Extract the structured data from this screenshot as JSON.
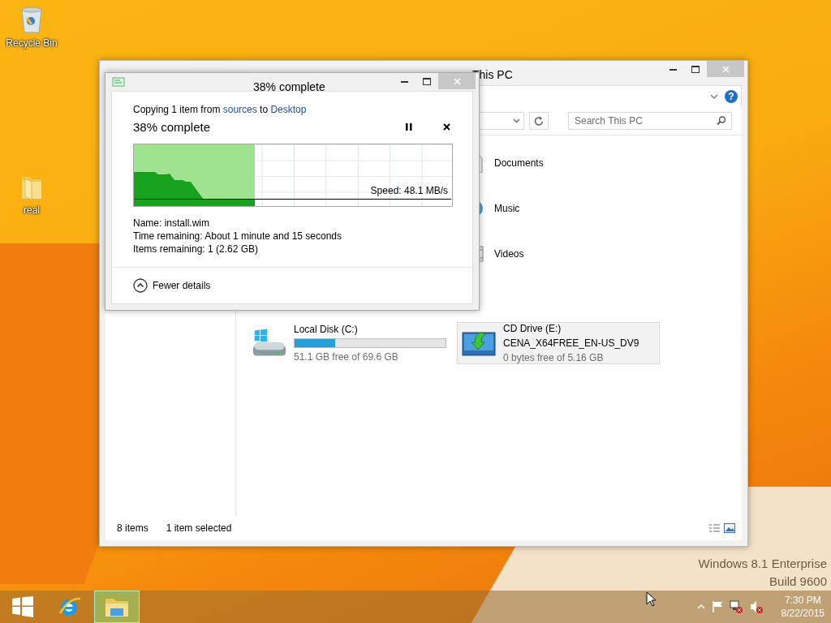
{
  "desktop_icons": [
    {
      "label": "Recycle Bin",
      "kind": "bin"
    },
    {
      "label": "real",
      "kind": "folder"
    }
  ],
  "explorer": {
    "title": "This PC",
    "help": "?",
    "search": {
      "placeholder": "Search This PC"
    },
    "folders": [
      {
        "label": "Documents"
      },
      {
        "label": "Music"
      },
      {
        "label": "Videos"
      }
    ],
    "drives": [
      {
        "name": "Local Disk (C:)",
        "kind": "disk",
        "level": 0.27,
        "free": "51.1 GB free of 69.6 GB",
        "selected": false
      },
      {
        "name": "CD Drive (E:)",
        "kind": "cd",
        "volume": "CENA_X64FREE_EN-US_DV9",
        "free": "0 bytes free of 5.16 GB",
        "selected": true
      }
    ],
    "status_bar": {
      "count": "8 items",
      "selection": "1 item selected"
    }
  },
  "copy_dialog": {
    "title": "38% complete",
    "prefix": "Copying 1 item from",
    "source": "sources",
    "connector": "to",
    "destination": "Desktop",
    "heading": "38% complete",
    "level": 0.38,
    "speed": "Speed: 48.1 MB/s",
    "details": [
      "Name:  install.wim",
      "Time remaining:  About 1 minute and 15 seconds",
      "Items remaining:  1 (2.62 GB)"
    ],
    "toggle": "Fewer details"
  },
  "edition": [
    "Windows 8.1 Enterprise",
    "Build 9600"
  ],
  "taskbar": {
    "apps": [
      {
        "kind": "start",
        "selected": false
      },
      {
        "kind": "browser",
        "selected": false
      },
      {
        "kind": "explorer",
        "selected": true
      }
    ],
    "time": "7:30 PM",
    "date": "8/22/2015"
  }
}
